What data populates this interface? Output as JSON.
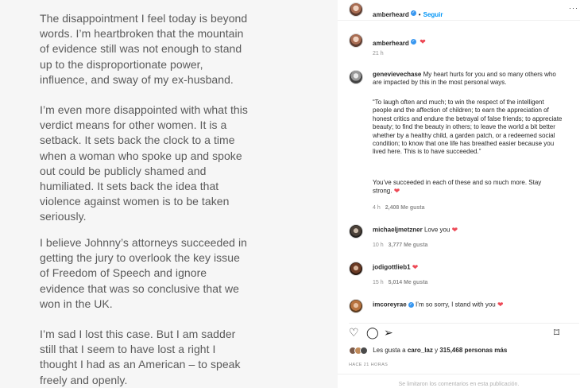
{
  "statement": {
    "paragraphs": [
      "The disappointment I feel today is beyond words. I’m heartbroken that the mountain of evidence still was not enough to stand up to the disproportionate power, influence, and sway of my ex-husband.",
      "I’m even more disappointed with what this verdict means for other women. It is a setback. It sets back the clock to a time when a woman who spoke up and spoke out could be publicly shamed and humiliated. It sets back the idea that violence against women is to be taken seriously.",
      "I believe Johnny’s attorneys succeeded in getting the jury to overlook the key issue of Freedom of Speech and ignore evidence that was so conclusive that we won in the UK.",
      "I’m sad I lost this case. But I am sadder still that I seem to have lost a right I thought I had as an American – to speak freely and openly."
    ]
  },
  "post": {
    "header": {
      "username": "amberheard",
      "follow_label": "Seguir",
      "more_label": "···"
    },
    "caption": {
      "username": "amberheard",
      "age": "21 h"
    },
    "comments": [
      {
        "username": "genevievechase",
        "text": "My heart hurts for you and so many others who are impacted by this in the most personal ways.",
        "quote": "“To laugh often and much; to win the respect of the intelligent people and the affection of children; to earn the appreciation of honest critics and endure the betrayal of false friends; to appreciate beauty; to find the beauty in others; to leave the world a bit better whether by a healthy child, a garden patch, or a redeemed social condition; to know that one life has breathed easier because you lived here. This is to have succeeded.”",
        "closing": "You’ve succeeded in each of these and so much more. Stay strong.",
        "age": "4 h",
        "likes": "2,408 Me gusta"
      },
      {
        "username": "michaeljmetzner",
        "text": "Love you",
        "age": "10 h",
        "likes": "3,777 Me gusta"
      },
      {
        "username": "jodigottlieb1",
        "text": "",
        "age": "15 h",
        "likes": "5,014 Me gusta"
      },
      {
        "username": "imcoreyrae",
        "text": "I’m so sorry, I stand with you"
      }
    ],
    "likes_line": {
      "prefix": "Les gusta a",
      "user": "caro_laz",
      "middle": "y",
      "count": "315,468 personas más"
    },
    "posted": "HACE 21 HORAS",
    "comments_limited": "Se limitaron los comentarios en esta publicación."
  },
  "icons": {
    "heart": "heart-icon",
    "comment": "comment-icon",
    "share": "share-icon",
    "save": "bookmark-icon",
    "verified": "verified-badge-icon"
  },
  "colors": {
    "accent": "#0095f6",
    "heart": "#ed4956",
    "verified": "#3897f0",
    "muted": "#8e8e8e"
  }
}
